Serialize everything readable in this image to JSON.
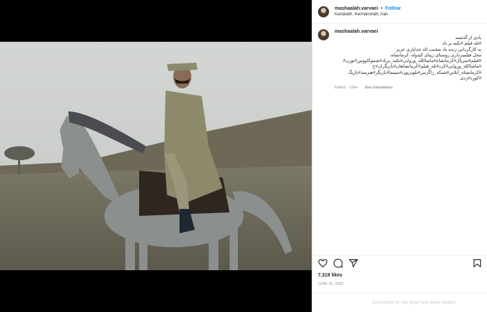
{
  "post": {
    "username": "mashaalah.varvaei",
    "separator": "•",
    "follow_label": "Follow",
    "location": "Kanduleh, Kermānshāh, Iran"
  },
  "caption": {
    "username": "mashaalah.varvaei",
    "lines": [
      "یادی از گذشته",
      "#تله فیلم #تکیه بر باد",
      "به کارگردانی زنده یاد صحبت اله خدایاری عزیز",
      "محل فیلمبرداری روستای زیبای کندوله .کرمانشاه.",
      "#فیلم#سریال#کرمانشاه#ماشاالله_وروایی#تکیه_برباد#شموکاووس#تورن#",
      "#ماشاالله_وروایی#کرد#تله_فیلم#کرمانشاهان#بازیگران#ح",
      "#کرمانشاه_آنلاین#شبکه_زاگرس#تلویزیون#سینما#بازیگر#هنرمند#بازیگ",
      "#کورد#ردی"
    ],
    "edited": "Edited · 139w",
    "see_translation": "See translation"
  },
  "actions": {
    "like_icon": "heart-icon",
    "comment_icon": "comment-icon",
    "share_icon": "share-icon",
    "save_icon": "bookmark-icon"
  },
  "likes": "7,318 likes",
  "date": "JUNE 26, 2020",
  "comments_notice": "Comments on this post have been limited."
}
